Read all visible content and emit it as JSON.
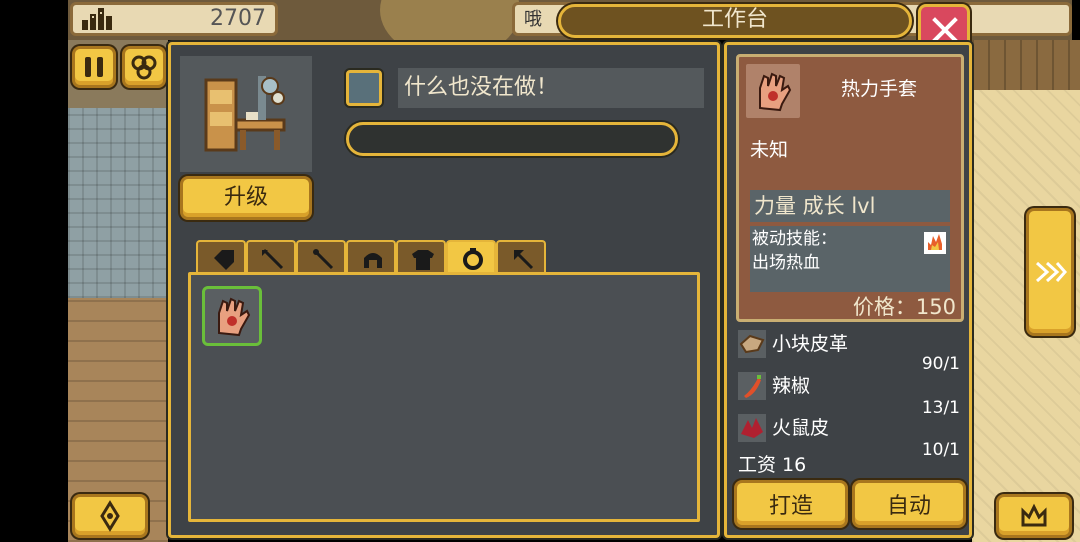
{
  "resources": {
    "value": "2707",
    "icon": "building-chart-icon"
  },
  "title_bar": {
    "title": "工作台",
    "behind_text": "哦"
  },
  "close": {
    "icon": "close-icon",
    "color": "#d9485e"
  },
  "workbench": {
    "upgrade_label": "升级",
    "status_text": "什么也没在做！",
    "progress": 0
  },
  "tabs": [
    {
      "icon": "tag-icon",
      "active": false
    },
    {
      "icon": "spear-icon",
      "active": false
    },
    {
      "icon": "wand-icon",
      "active": false
    },
    {
      "icon": "helmet-icon",
      "active": false
    },
    {
      "icon": "armor-icon",
      "active": false
    },
    {
      "icon": "ring-icon",
      "active": true
    },
    {
      "icon": "pickaxe-icon",
      "active": false
    }
  ],
  "inventory": [
    {
      "icon": "glove-icon",
      "selected": true
    }
  ],
  "item_card": {
    "name": "热力手套",
    "rarity": "未知",
    "stat": "力量 成长 lvl",
    "skill_label": "被动技能：",
    "skill_name": "出场热血",
    "price": "价格：150"
  },
  "materials": [
    {
      "name": "小块皮革",
      "count": "90/1",
      "icon": "leather-icon"
    },
    {
      "name": "辣椒",
      "count": "13/1",
      "icon": "chili-icon"
    },
    {
      "name": "火鼠皮",
      "count": "10/1",
      "icon": "fire-rat-hide-icon"
    }
  ],
  "wage": "工资 16",
  "buttons": {
    "craft": "打造",
    "auto": "自动"
  },
  "colors": {
    "accent": "#e5b53a",
    "panel": "#3e4246",
    "card": "#8e5a40",
    "button": "#f2c744"
  }
}
